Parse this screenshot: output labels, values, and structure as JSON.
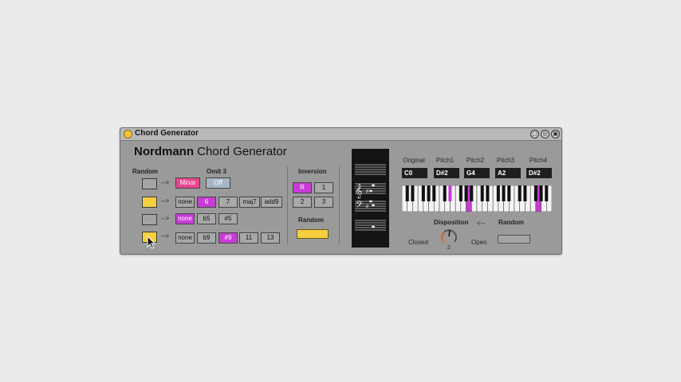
{
  "window": {
    "title": "Chord Generator",
    "buttons": [
      {
        "name": "fold",
        "glyph": "▢"
      },
      {
        "name": "hotswap",
        "glyph": "◎"
      },
      {
        "name": "save",
        "glyph": "▣"
      }
    ]
  },
  "brand": {
    "bold": "Nordmann",
    "rest": "Chord Generator"
  },
  "random_section": {
    "label": "Random",
    "omit_label": "Omit 3"
  },
  "rows": [
    {
      "random_on": false,
      "arrow": "-->",
      "options": [
        "Minor",
        "Off"
      ]
    },
    {
      "random_on": true,
      "arrow": "-->",
      "options": [
        "none",
        "6",
        "7",
        "maj7",
        "add9"
      ]
    },
    {
      "random_on": false,
      "arrow": "-->",
      "options": [
        "none",
        "b5",
        "#5"
      ]
    },
    {
      "random_on": true,
      "arrow": "-->",
      "options": [
        "none",
        "b9",
        "#9",
        "11",
        "13"
      ]
    }
  ],
  "inversion": {
    "label": "Inversion",
    "options": [
      "R",
      "1",
      "2",
      "3"
    ],
    "random_label": "Random"
  },
  "pitches": {
    "labels": [
      "Original",
      "Pitch1",
      "Pitch2",
      "Pitch3",
      "Pitch4"
    ],
    "values": [
      "C0",
      "D#2",
      "G4",
      "A2",
      "D#2"
    ]
  },
  "disposition": {
    "label": "Disposition",
    "arrow": "<--",
    "random_label": "Random",
    "closed": "Closed",
    "open": "Open",
    "value": "2"
  },
  "colors": {
    "accent_yellow": "#f5cf3e",
    "accent_magenta": "#c83cd6",
    "accent_pink": "#e8468e",
    "panel": "#9a9a9a"
  }
}
